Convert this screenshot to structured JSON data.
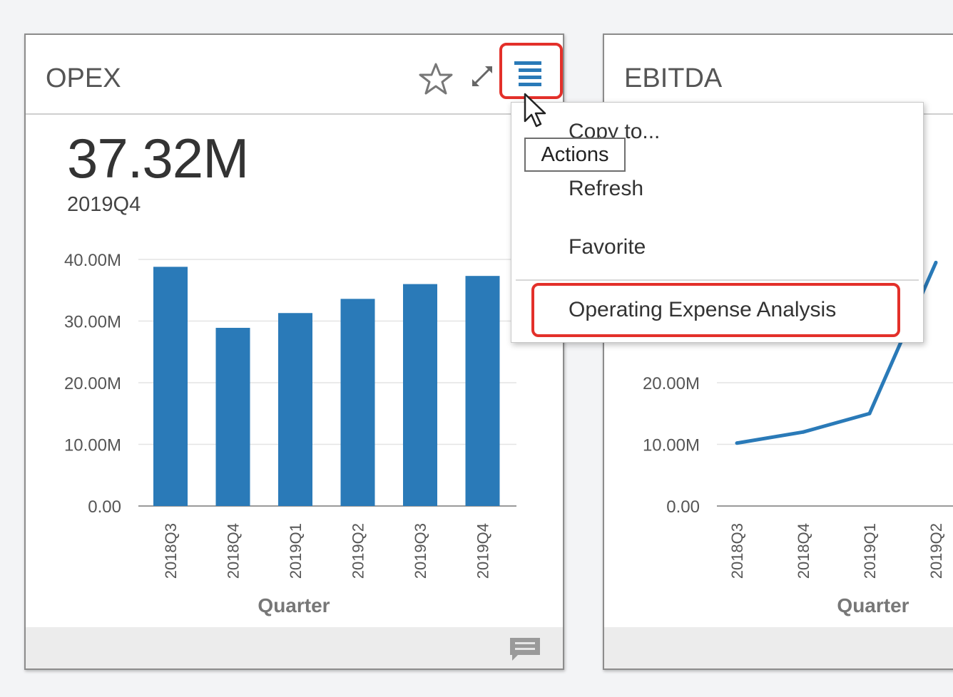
{
  "cards": [
    {
      "title": "OPEX",
      "kpi_value": "37.32M",
      "kpi_period": "2019Q4",
      "x_axis_title": "Quarter"
    },
    {
      "title": "EBITDA",
      "x_axis_title": "Quarter"
    }
  ],
  "icons": {
    "favorite": "star-icon",
    "expand": "expand-icon",
    "actions": "hamburger-menu-icon",
    "comment": "comment-icon",
    "cursor": "mouse-pointer-icon"
  },
  "tooltip": "Actions",
  "actions_menu": {
    "items": [
      "Copy to...",
      "Refresh",
      "Favorite",
      "Operating Expense Analysis"
    ],
    "highlighted": "Operating Expense Analysis"
  },
  "colors": {
    "series": "#2a7ab8",
    "highlight": "#e3302a"
  },
  "chart_data": [
    {
      "type": "bar",
      "categories": [
        "2018Q3",
        "2018Q4",
        "2019Q1",
        "2019Q2",
        "2019Q3",
        "2019Q4"
      ],
      "values": [
        38.8,
        28.9,
        31.3,
        33.6,
        36.0,
        37.32
      ],
      "xlabel": "Quarter",
      "ylabel": "",
      "ylim": [
        0,
        40
      ],
      "yticks": [
        "0.00",
        "10.00M",
        "20.00M",
        "30.00M",
        "40.00M"
      ],
      "grid": true
    },
    {
      "type": "line",
      "categories": [
        "2018Q3",
        "2018Q4",
        "2019Q1",
        "2019Q2"
      ],
      "values": [
        10.2,
        12.0,
        15.0,
        39.5
      ],
      "xlabel": "Quarter",
      "ylabel": "",
      "ylim": [
        0,
        40
      ],
      "yticks": [
        "0.00",
        "10.00M",
        "20.00M"
      ],
      "grid": true
    }
  ]
}
